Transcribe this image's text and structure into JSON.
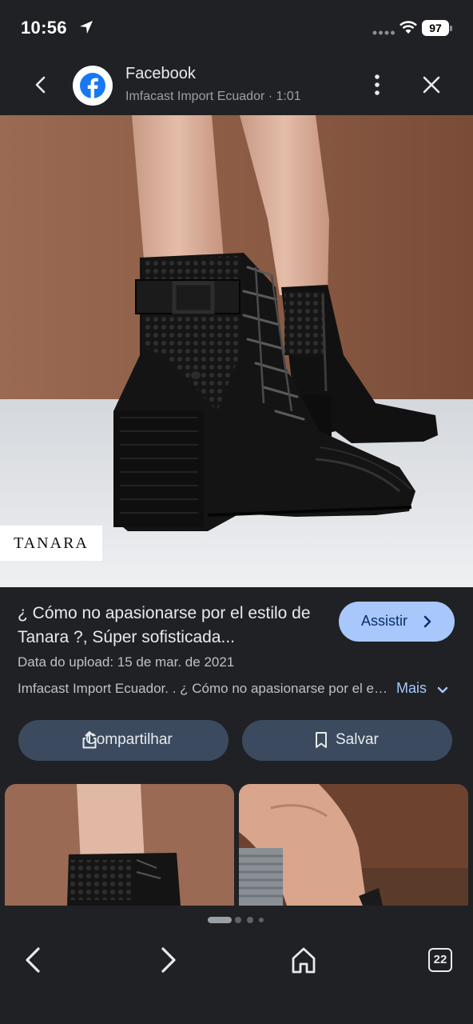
{
  "status_bar": {
    "time": "10:56",
    "battery": "97",
    "icons": [
      "location-arrow-icon",
      "signal-dots-icon",
      "wifi-icon",
      "battery-icon"
    ]
  },
  "header": {
    "title": "Facebook",
    "subtitle": "Imfacast Import Ecuador · 1:01",
    "icons": [
      "back-arrow-icon",
      "facebook-logo",
      "more-vert-icon",
      "close-icon"
    ]
  },
  "main_image": {
    "brand_tag": "TANARA"
  },
  "result": {
    "title": "¿ Cómo no apasionarse por el estilo de Tanara ?, Súper sofisticada...",
    "watch_label": "Assistir",
    "upload_date": "Data do upload: 15 de mar. de 2021",
    "description": "Imfacast Import Ecuador. . ¿ Cómo no apasionarse por el estilo de Tanara ?",
    "more_label": "Mais"
  },
  "actions": {
    "share_label": "Compartilhar",
    "save_label": "Salvar"
  },
  "bottom_nav": {
    "tab_count": "22",
    "icons": [
      "back-icon",
      "forward-icon",
      "home-icon",
      "tabs-icon"
    ]
  },
  "colors": {
    "background": "#202124",
    "accent_button": "#a8c7fa",
    "pill_button": "#3c4a5f",
    "facebook_blue": "#1877f2"
  }
}
